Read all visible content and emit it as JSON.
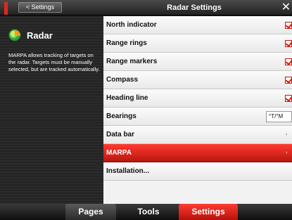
{
  "header": {
    "back_label": "< Settings",
    "title": "Radar Settings",
    "close_label": "✕"
  },
  "sidebar": {
    "icon": "radar-icon",
    "title": "Radar",
    "description": "MARPA allows tracking of targets on the radar. Targets must be manually selected, but are tracked automatically."
  },
  "settings": [
    {
      "label": "North indicator",
      "control": "checkbox",
      "checked": true
    },
    {
      "label": "Range rings",
      "control": "checkbox",
      "checked": true
    },
    {
      "label": "Range markers",
      "control": "checkbox",
      "checked": true
    },
    {
      "label": "Compass",
      "control": "checkbox",
      "checked": true
    },
    {
      "label": "Heading line",
      "control": "checkbox",
      "checked": true
    },
    {
      "label": "Bearings",
      "control": "dropdown",
      "value": "°T/°M"
    },
    {
      "label": "Data bar",
      "control": "submenu",
      "arrow": "›"
    },
    {
      "label": "MARPA",
      "control": "submenu",
      "arrow": "›",
      "selected": true
    },
    {
      "label": "Installation...",
      "control": "submenu"
    }
  ],
  "bottom_tabs": [
    {
      "label": "Pages"
    },
    {
      "label": "Tools"
    },
    {
      "label": "Settings",
      "active": true
    }
  ],
  "colors": {
    "accent": "#e0281e",
    "selected_row": "#d8231a"
  }
}
